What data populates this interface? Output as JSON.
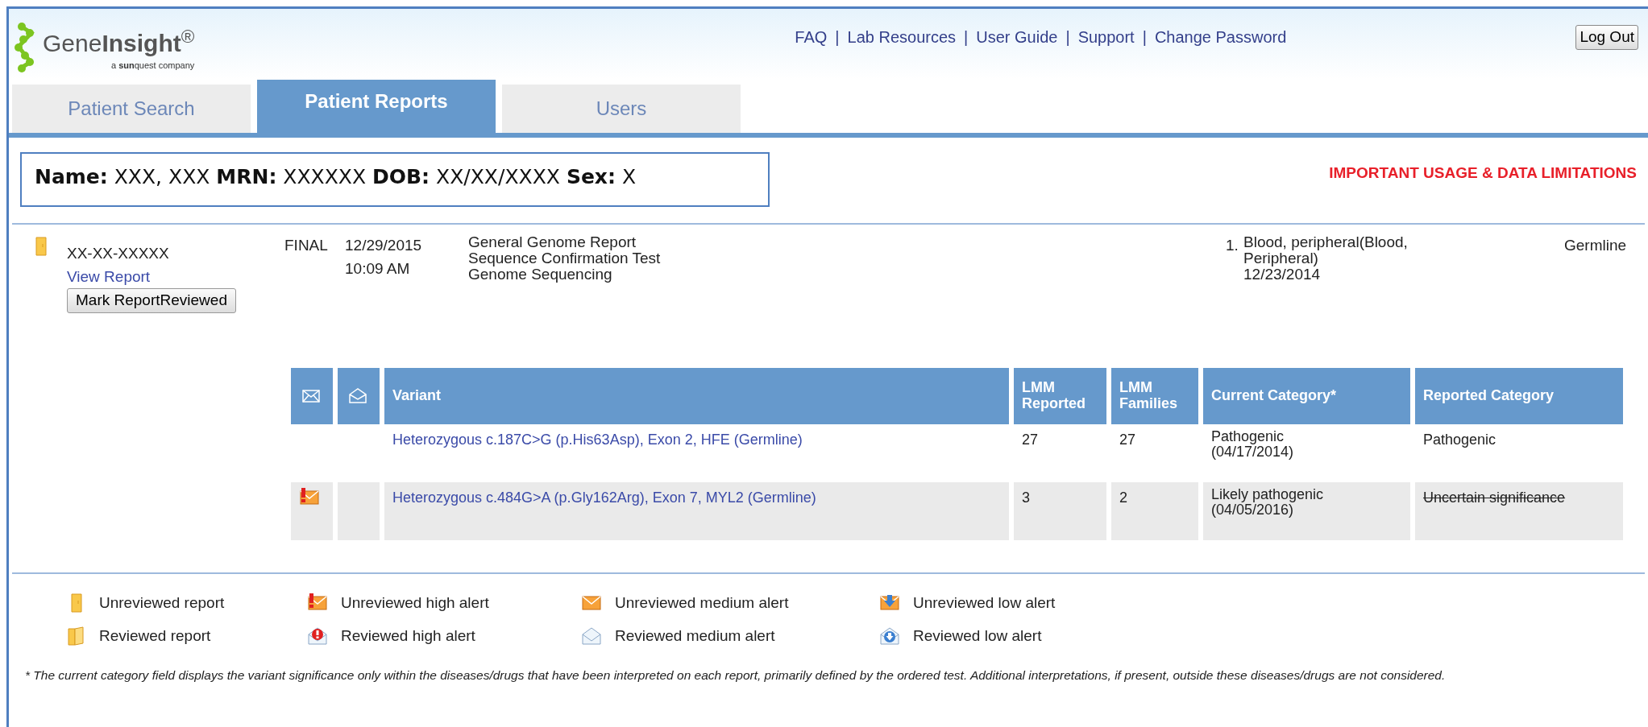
{
  "logo": {
    "name": "Gene**Insight**$^{®}$",
    "tagline": "a **sun**quest company"
  },
  "top_links": [
    {
      "label": "FAQ"
    },
    {
      "separator": "|",
      "label": "Lab Resources"
    },
    {
      "separator": "|",
      "label": "User Guide"
    },
    {
      "separator": "|",
      "label": "Support"
    },
    {
      "separator": "|",
      "label": "Change Password"
    }
  ],
  "logout": "Log Out",
  "tabs": [
    {
      "label": "Patient Search",
      "selected": false
    },
    {
      "label": "Patient Reports",
      "selected": true
    },
    {
      "label": "Users",
      "selected": false
    }
  ],
  "patient": "**Name:** XXX, XXX **MRN:** XXXXXX **DOB:** XX/XX/XXXX **Sex:** X",
  "usage_link": "IMPORTANT USAGE & DATA LIMITATIONS",
  "report": {
    "reviewed": false,
    "accession": "XX-XX-XXXXX",
    "view_link": "View Report",
    "mark_button": "Mark ReportReviewed",
    "status": "FINAL",
    "date": "12/29/2015",
    "time": "10:09 AM",
    "tests": [
      "General Genome Report",
      "Sequence Confirmation Test",
      "Genome Sequencing"
    ],
    "specimens": [
      {
        "number": "1.",
        "text": "Blood, peripheral(Blood, Peripheral)",
        "date": "12/23/2014"
      }
    ],
    "origin": "Germline"
  },
  "variants_table": {
    "columns": [
      "Variant",
      "LMM Reported",
      "LMM Families",
      "Current Category*",
      "Reported Category"
    ],
    "rows": [
      {
        "kind": "plain",
        "variant": "Heterozygous c.187C>G (p.His63Asp), Exon 2, HFE (Germline)",
        "lmm_reported": "27",
        "lmm_families": "27",
        "current_category": "Pathogenic",
        "current_date": "(04/17/2014)",
        "reported_category": "Pathogenic",
        "reported_struck": false
      },
      {
        "kind": "unreviewed-high",
        "variant": "Heterozygous c.484G>A (p.Gly162Arg), Exon 7, MYL2 (Germline)",
        "lmm_reported": "3",
        "lmm_families": "2",
        "current_category": "Likely pathogenic",
        "current_date": "(04/05/2016)",
        "reported_category": "Uncertain significance",
        "reported_struck": true
      }
    ]
  },
  "legend": [
    {
      "kind": "unreviewed-report",
      "label": "Unreviewed report"
    },
    {
      "kind": "unreviewed-high",
      "label": "Unreviewed high alert"
    },
    {
      "kind": "unreviewed-medium",
      "label": "Unreviewed medium alert"
    },
    {
      "kind": "unreviewed-low",
      "label": "Unreviewed low alert"
    },
    {
      "kind": "reviewed-report",
      "label": "Reviewed report"
    },
    {
      "kind": "reviewed-high",
      "label": "Reviewed high alert"
    },
    {
      "kind": "reviewed-medium",
      "label": "Reviewed medium alert"
    },
    {
      "kind": "reviewed-low",
      "label": "Reviewed low alert"
    }
  ],
  "footnote": "* The current category field displays the variant significance only within the diseases/drugs that have been interpreted on each report, primarily defined by the ordered test. Additional interpretations, if present, outside these diseases/drugs are not considered."
}
